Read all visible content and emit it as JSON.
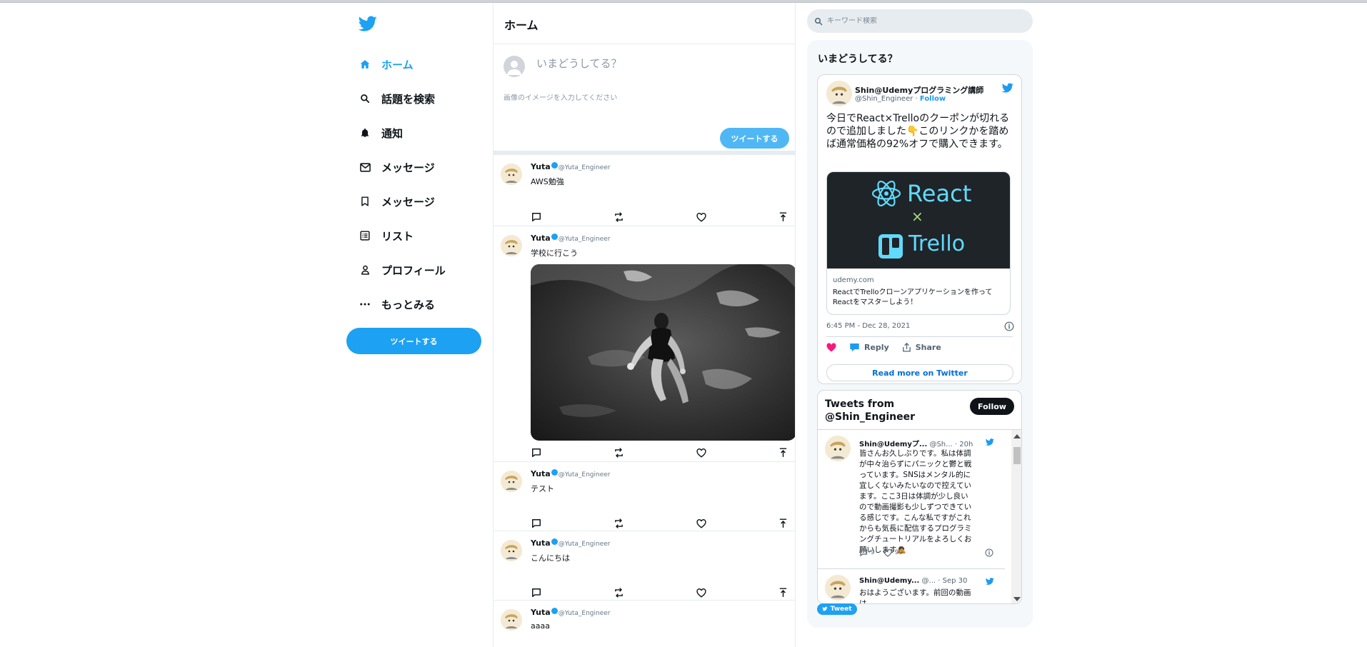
{
  "sidebar": {
    "items": [
      {
        "label": "ホーム",
        "icon": "home-icon",
        "active": true
      },
      {
        "label": "話題を検索",
        "icon": "search-icon"
      },
      {
        "label": "通知",
        "icon": "bell-icon"
      },
      {
        "label": "メッセージ",
        "icon": "mail-icon"
      },
      {
        "label": "メッセージ",
        "icon": "bookmark-icon"
      },
      {
        "label": "リスト",
        "icon": "list-icon"
      },
      {
        "label": "プロフィール",
        "icon": "person-icon"
      },
      {
        "label": "もっとみる",
        "icon": "more-icon"
      }
    ],
    "tweet_button": "ツイートする"
  },
  "main": {
    "title": "ホーム",
    "composer": {
      "placeholder": "いまどうしてる？",
      "image_placeholder": "画像のイメージを入力してください",
      "button": "ツイートする"
    },
    "posts": [
      {
        "name": "Yuta",
        "handle": "@Yuta_Engineer",
        "text": "AWS勉強"
      },
      {
        "name": "Yuta",
        "handle": "@Yuta_Engineer",
        "text": "学校に行こう",
        "has_image": true
      },
      {
        "name": "Yuta",
        "handle": "@Yuta_Engineer",
        "text": "テスト"
      },
      {
        "name": "Yuta",
        "handle": "@Yuta_Engineer",
        "text": "こんにちは"
      },
      {
        "name": "Yuta",
        "handle": "@Yuta_Engineer",
        "text": "aaaa"
      }
    ]
  },
  "right": {
    "search_placeholder": "キーワード検索",
    "panel_title": "いまどうしてる？",
    "embed": {
      "name": "Shin@Udemyプログラミング講師",
      "handle": "@Shin_Engineer",
      "separator": " · ",
      "follow": "Follow",
      "text": "今日でReact×Trelloのクーポンが切れるので追加しました👇このリンクかを踏めば通常価格の92%オフで購入できます。",
      "card_brand_top": "React",
      "card_brand_x": "×",
      "card_brand_bottom": "Trello",
      "card_domain": "udemy.com",
      "card_title": "ReactでTrelloクローンアプリケーションを作ってReactをマスターしよう！",
      "date": "6:45 PM - Dec 28, 2021",
      "reply": "Reply",
      "share": "Share",
      "read_more": "Read more on Twitter"
    },
    "timeline": {
      "title": "Tweets from @Shin_Engineer",
      "follow": "Follow",
      "tweets": [
        {
          "name": "Shin@Udemyプ...",
          "handle": "@Sh...",
          "time": "· 20h",
          "text": "皆さんお久しぶりです。私は体調が中々治らずにパニックと鬱と戦っています。SNSはメンタル的に宜しくないみたいなので控えています。ここ3日は体調が少し良いので動画撮影も少しずつできている感じです。こんな私ですがこれからも気長に配信するプログラミングチュートリアルをよろしくお願いします🙇",
          "replies": "9",
          "likes": "99"
        },
        {
          "name": "Shin@Udemy...",
          "handle": "@...",
          "time": "· Sep 30",
          "text": "おはようございます。前回の動画は"
        }
      ]
    },
    "tweet_button": "Tweet"
  },
  "colors": {
    "accent": "#1da1f2",
    "like": "#f91880",
    "link": "#006fd6",
    "react": "#61dafb"
  }
}
